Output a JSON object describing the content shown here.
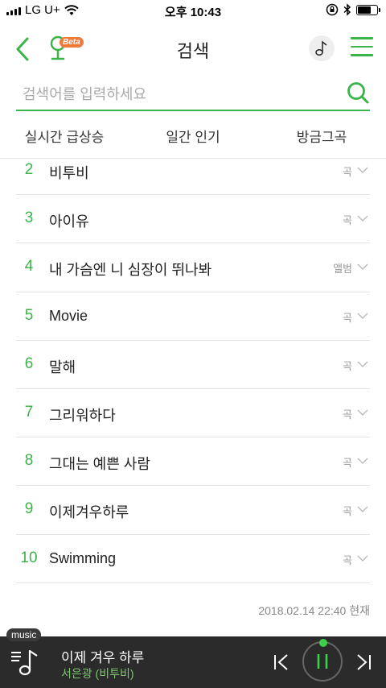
{
  "status_bar": {
    "carrier": "LG U+",
    "time": "오후 10:43",
    "battery_level": 0.7
  },
  "header": {
    "title": "검색",
    "beta_label": "Beta"
  },
  "search": {
    "placeholder": "검색어를 입력하세요",
    "value": ""
  },
  "tabs": [
    {
      "label": "실시간 급상승",
      "active": true
    },
    {
      "label": "일간 인기",
      "active": false
    },
    {
      "label": "방금그곡",
      "active": false
    }
  ],
  "chart_rows": [
    {
      "rank": "2",
      "title": "비투비",
      "type": "곡"
    },
    {
      "rank": "3",
      "title": "아이유",
      "type": "곡"
    },
    {
      "rank": "4",
      "title": "내 가슴엔 니 심장이 뛰나봐",
      "type": "앨범"
    },
    {
      "rank": "5",
      "title": "Movie",
      "type": "곡"
    },
    {
      "rank": "6",
      "title": "말해",
      "type": "곡"
    },
    {
      "rank": "7",
      "title": "그리워하다",
      "type": "곡"
    },
    {
      "rank": "8",
      "title": "그대는 예쁜 사람",
      "type": "곡"
    },
    {
      "rank": "9",
      "title": "이제겨우하루",
      "type": "곡"
    },
    {
      "rank": "10",
      "title": "Swimming",
      "type": "곡"
    }
  ],
  "timestamp": "2018.02.14 22:40 현재",
  "player": {
    "tag": "music",
    "track_title": "이제 겨우 하루",
    "track_artist": "서은광 (비투비)"
  },
  "colors": {
    "accent": "#3bb44a",
    "player_bg": "#2b2b2b",
    "beta_badge": "#f07a3a"
  }
}
